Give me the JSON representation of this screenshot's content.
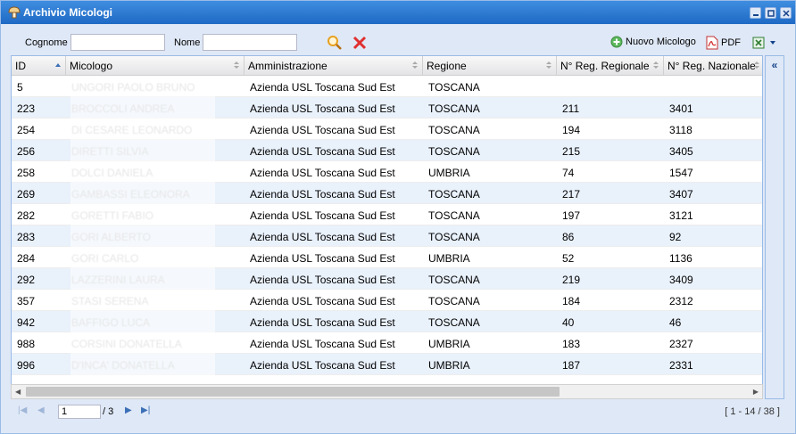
{
  "window": {
    "title": "Archivio Micologi"
  },
  "filters": {
    "surname_label": "Cognome",
    "surname_value": "",
    "name_label": "Nome",
    "name_value": ""
  },
  "toolbar": {
    "new_label": "Nuovo Micologo",
    "pdf_label": "PDF"
  },
  "columns": [
    "ID",
    "Micologo",
    "Amministrazione",
    "Regione",
    "N° Reg. Regionale",
    "N° Reg. Nazionale"
  ],
  "rows": [
    {
      "id": "5",
      "name": "UNGORI PAOLO BRUNO",
      "admin": "Azienda USL Toscana Sud Est",
      "region": "TOSCANA",
      "reg": "",
      "naz": ""
    },
    {
      "id": "223",
      "name": "BROCCOLI ANDREA",
      "admin": "Azienda USL Toscana Sud Est",
      "region": "TOSCANA",
      "reg": "211",
      "naz": "3401"
    },
    {
      "id": "254",
      "name": "DI CESARE LEONARDO",
      "admin": "Azienda USL Toscana Sud Est",
      "region": "TOSCANA",
      "reg": "194",
      "naz": "3118"
    },
    {
      "id": "256",
      "name": "DIRETTI SILVIA",
      "admin": "Azienda USL Toscana Sud Est",
      "region": "TOSCANA",
      "reg": "215",
      "naz": "3405"
    },
    {
      "id": "258",
      "name": "DOLCI DANIELA",
      "admin": "Azienda USL Toscana Sud Est",
      "region": "UMBRIA",
      "reg": "74",
      "naz": "1547"
    },
    {
      "id": "269",
      "name": "GAMBASSI ELEONORA",
      "admin": "Azienda USL Toscana Sud Est",
      "region": "TOSCANA",
      "reg": "217",
      "naz": "3407"
    },
    {
      "id": "282",
      "name": "GORETTI FABIO",
      "admin": "Azienda USL Toscana Sud Est",
      "region": "TOSCANA",
      "reg": "197",
      "naz": "3121"
    },
    {
      "id": "283",
      "name": "GORI ALBERTO",
      "admin": "Azienda USL Toscana Sud Est",
      "region": "TOSCANA",
      "reg": "86",
      "naz": "92"
    },
    {
      "id": "284",
      "name": "GORI CARLO",
      "admin": "Azienda USL Toscana Sud Est",
      "region": "UMBRIA",
      "reg": "52",
      "naz": "1136"
    },
    {
      "id": "292",
      "name": "LAZZERINI LAURA",
      "admin": "Azienda USL Toscana Sud Est",
      "region": "TOSCANA",
      "reg": "219",
      "naz": "3409"
    },
    {
      "id": "357",
      "name": "STASI SERENA",
      "admin": "Azienda USL Toscana Sud Est",
      "region": "TOSCANA",
      "reg": "184",
      "naz": "2312"
    },
    {
      "id": "942",
      "name": "BAFFIGO LUCA",
      "admin": "Azienda USL Toscana Sud Est",
      "region": "TOSCANA",
      "reg": "40",
      "naz": "46"
    },
    {
      "id": "988",
      "name": "CORSINI DONATELLA",
      "admin": "Azienda USL Toscana Sud Est",
      "region": "UMBRIA",
      "reg": "183",
      "naz": "2327"
    },
    {
      "id": "996",
      "name": "D'INCA' DONATELLA",
      "admin": "Azienda USL Toscana Sud Est",
      "region": "UMBRIA",
      "reg": "187",
      "naz": "2331"
    }
  ],
  "pager": {
    "page": "1",
    "total_pages": "/ 3",
    "info": "[ 1 - 14 / 38 ]"
  },
  "colors": {
    "title_bar": "#1e69c4",
    "frame": "#dfe8f6",
    "alt_row": "#e9f1fb",
    "delete_red": "#e03030",
    "search_orange": "#e8a020"
  }
}
